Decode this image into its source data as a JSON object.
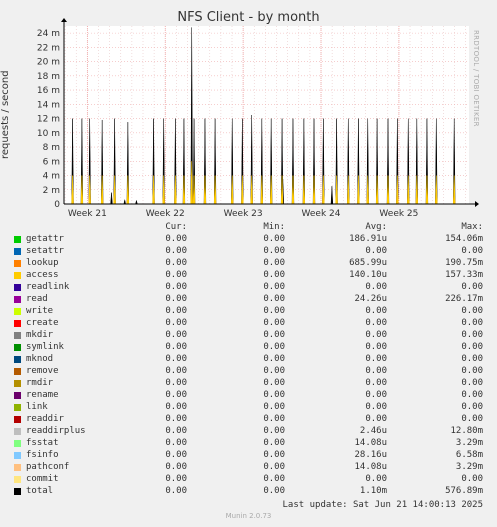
{
  "title": "NFS Client - by month",
  "side_credit": "RRDTOOL / TOBI OETIKER",
  "footer": "Munin 2.0.73",
  "last_update": "Last update:  Sat Jun 21 14:00:13 2025",
  "legend_headers": {
    "cur": "Cur:",
    "min": "Min:",
    "avg": "Avg:",
    "max": "Max:"
  },
  "legend": [
    {
      "name": "getattr",
      "color": "#00cc00",
      "cur": "0.00",
      "min": "0.00",
      "avg": "186.91u",
      "max": "154.06m"
    },
    {
      "name": "setattr",
      "color": "#0066b3",
      "cur": "0.00",
      "min": "0.00",
      "avg": "0.00",
      "max": "0.00"
    },
    {
      "name": "lookup",
      "color": "#ff8000",
      "cur": "0.00",
      "min": "0.00",
      "avg": "685.99u",
      "max": "190.75m"
    },
    {
      "name": "access",
      "color": "#ffcc00",
      "cur": "0.00",
      "min": "0.00",
      "avg": "140.10u",
      "max": "157.33m"
    },
    {
      "name": "readlink",
      "color": "#330099",
      "cur": "0.00",
      "min": "0.00",
      "avg": "0.00",
      "max": "0.00"
    },
    {
      "name": "read",
      "color": "#990099",
      "cur": "0.00",
      "min": "0.00",
      "avg": "24.26u",
      "max": "226.17m"
    },
    {
      "name": "write",
      "color": "#ccff00",
      "cur": "0.00",
      "min": "0.00",
      "avg": "0.00",
      "max": "0.00"
    },
    {
      "name": "create",
      "color": "#ff0000",
      "cur": "0.00",
      "min": "0.00",
      "avg": "0.00",
      "max": "0.00"
    },
    {
      "name": "mkdir",
      "color": "#808080",
      "cur": "0.00",
      "min": "0.00",
      "avg": "0.00",
      "max": "0.00"
    },
    {
      "name": "symlink",
      "color": "#008f00",
      "cur": "0.00",
      "min": "0.00",
      "avg": "0.00",
      "max": "0.00"
    },
    {
      "name": "mknod",
      "color": "#00487d",
      "cur": "0.00",
      "min": "0.00",
      "avg": "0.00",
      "max": "0.00"
    },
    {
      "name": "remove",
      "color": "#b35a00",
      "cur": "0.00",
      "min": "0.00",
      "avg": "0.00",
      "max": "0.00"
    },
    {
      "name": "rmdir",
      "color": "#b38f00",
      "cur": "0.00",
      "min": "0.00",
      "avg": "0.00",
      "max": "0.00"
    },
    {
      "name": "rename",
      "color": "#6b006b",
      "cur": "0.00",
      "min": "0.00",
      "avg": "0.00",
      "max": "0.00"
    },
    {
      "name": "link",
      "color": "#8fb300",
      "cur": "0.00",
      "min": "0.00",
      "avg": "0.00",
      "max": "0.00"
    },
    {
      "name": "readdir",
      "color": "#b30000",
      "cur": "0.00",
      "min": "0.00",
      "avg": "0.00",
      "max": "0.00"
    },
    {
      "name": "readdirplus",
      "color": "#bebebe",
      "cur": "0.00",
      "min": "0.00",
      "avg": "2.46u",
      "max": "12.80m"
    },
    {
      "name": "fsstat",
      "color": "#80ff80",
      "cur": "0.00",
      "min": "0.00",
      "avg": "14.08u",
      "max": "3.29m"
    },
    {
      "name": "fsinfo",
      "color": "#80c9ff",
      "cur": "0.00",
      "min": "0.00",
      "avg": "28.16u",
      "max": "6.58m"
    },
    {
      "name": "pathconf",
      "color": "#ffc080",
      "cur": "0.00",
      "min": "0.00",
      "avg": "14.08u",
      "max": "3.29m"
    },
    {
      "name": "commit",
      "color": "#ffe680",
      "cur": "0.00",
      "min": "0.00",
      "avg": "0.00",
      "max": "0.00"
    },
    {
      "name": "total",
      "color": "#000000",
      "cur": "0.00",
      "min": "0.00",
      "avg": "1.10m",
      "max": "576.89m"
    }
  ],
  "chart_data": {
    "type": "line",
    "title": "NFS Client - by month",
    "ylabel": "requests / second",
    "xlabel": "",
    "ylim": [
      0,
      25
    ],
    "y_unit": "m",
    "y_ticks": [
      0,
      2,
      4,
      6,
      8,
      10,
      12,
      14,
      16,
      18,
      20,
      22,
      24
    ],
    "y_tick_labels": [
      "0",
      "2 m",
      "4 m",
      "6 m",
      "8 m",
      "10 m",
      "12 m",
      "14 m",
      "16 m",
      "18 m",
      "20 m",
      "22 m",
      "24 m"
    ],
    "x_ticks": [
      "Week 21",
      "Week 22",
      "Week 23",
      "Week 24",
      "Week 25"
    ],
    "x_range": [
      20.7,
      25.9
    ],
    "grid": true,
    "series": [
      {
        "name": "total",
        "color": "#000000",
        "peaks": [
          [
            20.81,
            12
          ],
          [
            20.93,
            12
          ],
          [
            21.03,
            12
          ],
          [
            21.19,
            11.8
          ],
          [
            21.31,
            1.6
          ],
          [
            21.35,
            12
          ],
          [
            21.48,
            0.6
          ],
          [
            21.52,
            11.5
          ],
          [
            21.63,
            0.5
          ],
          [
            21.85,
            12
          ],
          [
            21.98,
            12
          ],
          [
            22.13,
            12
          ],
          [
            22.24,
            12
          ],
          [
            22.34,
            24.8
          ],
          [
            22.37,
            12
          ],
          [
            22.51,
            12
          ],
          [
            22.64,
            12
          ],
          [
            22.86,
            12
          ],
          [
            22.99,
            12
          ],
          [
            23.11,
            12.5
          ],
          [
            23.24,
            12
          ],
          [
            23.36,
            12
          ],
          [
            23.5,
            12
          ],
          [
            23.51,
            3.5
          ],
          [
            23.64,
            12
          ],
          [
            23.78,
            12
          ],
          [
            23.91,
            12
          ],
          [
            24.03,
            12
          ],
          [
            24.14,
            2.5
          ],
          [
            24.2,
            12
          ],
          [
            24.35,
            12
          ],
          [
            24.48,
            12
          ],
          [
            24.6,
            12
          ],
          [
            24.72,
            12
          ],
          [
            24.86,
            12
          ],
          [
            24.98,
            12
          ],
          [
            25.12,
            12
          ],
          [
            25.23,
            12
          ],
          [
            25.36,
            12
          ],
          [
            25.48,
            12
          ],
          [
            25.71,
            12
          ]
        ]
      },
      {
        "name": "lookup",
        "color": "#ff8000",
        "peaks": [
          [
            20.81,
            2.2
          ],
          [
            20.93,
            2.2
          ],
          [
            21.03,
            2.2
          ],
          [
            21.19,
            2.2
          ],
          [
            21.35,
            2.2
          ],
          [
            21.52,
            2.2
          ],
          [
            21.85,
            2.2
          ],
          [
            21.98,
            2.2
          ],
          [
            22.13,
            2.2
          ],
          [
            22.24,
            2.2
          ],
          [
            22.34,
            4.5
          ],
          [
            22.37,
            2.2
          ],
          [
            22.51,
            2.2
          ],
          [
            22.64,
            2.2
          ],
          [
            22.86,
            2.2
          ],
          [
            22.99,
            2.2
          ],
          [
            23.11,
            2.2
          ],
          [
            23.24,
            2.2
          ],
          [
            23.36,
            2.2
          ],
          [
            23.5,
            2.2
          ],
          [
            23.64,
            2.2
          ],
          [
            23.78,
            2.2
          ],
          [
            23.91,
            2.2
          ],
          [
            24.03,
            2.2
          ],
          [
            24.2,
            2.2
          ],
          [
            24.35,
            2.2
          ],
          [
            24.48,
            2.2
          ],
          [
            24.6,
            2.2
          ],
          [
            24.72,
            2.2
          ],
          [
            24.86,
            2.2
          ],
          [
            24.98,
            2.2
          ],
          [
            25.12,
            2.2
          ],
          [
            25.23,
            2.2
          ],
          [
            25.36,
            2.2
          ],
          [
            25.48,
            2.2
          ],
          [
            25.71,
            2.2
          ]
        ]
      },
      {
        "name": "access",
        "color": "#ffcc00",
        "peaks": [
          [
            20.81,
            4.0
          ],
          [
            20.93,
            4.0
          ],
          [
            21.03,
            4.0
          ],
          [
            21.19,
            4.0
          ],
          [
            21.35,
            4.0
          ],
          [
            21.52,
            4.0
          ],
          [
            21.85,
            4.0
          ],
          [
            21.98,
            4.0
          ],
          [
            22.13,
            4.0
          ],
          [
            22.24,
            4.0
          ],
          [
            22.34,
            6.0
          ],
          [
            22.37,
            4.0
          ],
          [
            22.51,
            4.0
          ],
          [
            22.64,
            4.0
          ],
          [
            22.86,
            4.0
          ],
          [
            22.99,
            4.0
          ],
          [
            23.11,
            4.0
          ],
          [
            23.24,
            4.0
          ],
          [
            23.36,
            4.0
          ],
          [
            23.5,
            4.0
          ],
          [
            23.64,
            4.0
          ],
          [
            23.78,
            4.0
          ],
          [
            23.91,
            4.0
          ],
          [
            24.03,
            4.0
          ],
          [
            24.2,
            4.0
          ],
          [
            24.35,
            4.0
          ],
          [
            24.48,
            4.0
          ],
          [
            24.6,
            4.0
          ],
          [
            24.72,
            4.0
          ],
          [
            24.86,
            4.0
          ],
          [
            24.98,
            4.0
          ],
          [
            25.12,
            4.0
          ],
          [
            25.23,
            4.0
          ],
          [
            25.36,
            4.0
          ],
          [
            25.48,
            4.0
          ],
          [
            25.71,
            4.0
          ]
        ]
      }
    ]
  }
}
